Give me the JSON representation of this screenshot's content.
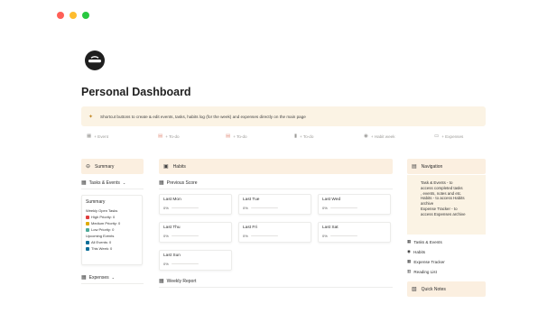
{
  "window": {
    "traffic_lights": [
      "#ff5f57",
      "#febc2e",
      "#28c840"
    ]
  },
  "page": {
    "icon": "no-smoking-circle-icon",
    "title": "Personal Dashboard",
    "callout": "Shortcut buttons to create & edit events, tasks, habits log (for the week) and expenses directly on the main page"
  },
  "shortcuts": [
    {
      "icon": "calendar-icon",
      "label": "+ Event"
    },
    {
      "icon": "note-icon",
      "label": "+ To-do"
    },
    {
      "icon": "note-icon",
      "label": "+ To-do"
    },
    {
      "icon": "bookmark-icon",
      "label": "+ To-do"
    },
    {
      "icon": "check-circle-icon",
      "label": "+ Habit week"
    },
    {
      "icon": "money-icon",
      "label": "+ Expenses"
    }
  ],
  "left": {
    "summary_header": "Summary",
    "tasks_events_label": "Tasks & Events",
    "card": {
      "title": "Summary",
      "lines": [
        {
          "text": "Weekly Open Tasks"
        },
        {
          "text": "High Priority: 0",
          "color": "#e03e3e"
        },
        {
          "text": "Medium Priority: 0",
          "color": "#dfab01"
        },
        {
          "text": "Low Priority: 0",
          "color": "#4dab9a"
        },
        {
          "text": "Upcoming Events"
        },
        {
          "text": "All Events: 0",
          "color": "#0b6e99"
        },
        {
          "text": "This Week: 0",
          "color": "#0b6e99"
        }
      ]
    },
    "expenses_label": "Expenses"
  },
  "middle": {
    "habits_header": "Habits",
    "previous_score_label": "Previous Score",
    "cards": [
      {
        "name": "Last Mon",
        "percent": "0%"
      },
      {
        "name": "Last Tue",
        "percent": "0%"
      },
      {
        "name": "Last Wed",
        "percent": "0%"
      },
      {
        "name": "Last Thu",
        "percent": "0%"
      },
      {
        "name": "Last Fri",
        "percent": "0%"
      },
      {
        "name": "Last Sat",
        "percent": "0%"
      },
      {
        "name": "Last Sun",
        "percent": "0%"
      }
    ],
    "weekly_report_label": "Weekly Report"
  },
  "right": {
    "navigation_header": "Navigation",
    "nav_lines": [
      "Task & Events - to",
      "access completed tasks",
      ", events, notes and etc.",
      "Habits - to access Habits",
      "archive",
      "Expense Tracker - to",
      "access Expenses archive"
    ],
    "links": [
      {
        "icon": "grid-icon",
        "label": "Tasks & Events"
      },
      {
        "icon": "check-circle-icon",
        "label": "Habits"
      },
      {
        "icon": "grid-icon",
        "label": "Expense Tracker"
      },
      {
        "icon": "book-icon",
        "label": "Reading List"
      }
    ],
    "quick_notes_label": "Quick Notes"
  }
}
